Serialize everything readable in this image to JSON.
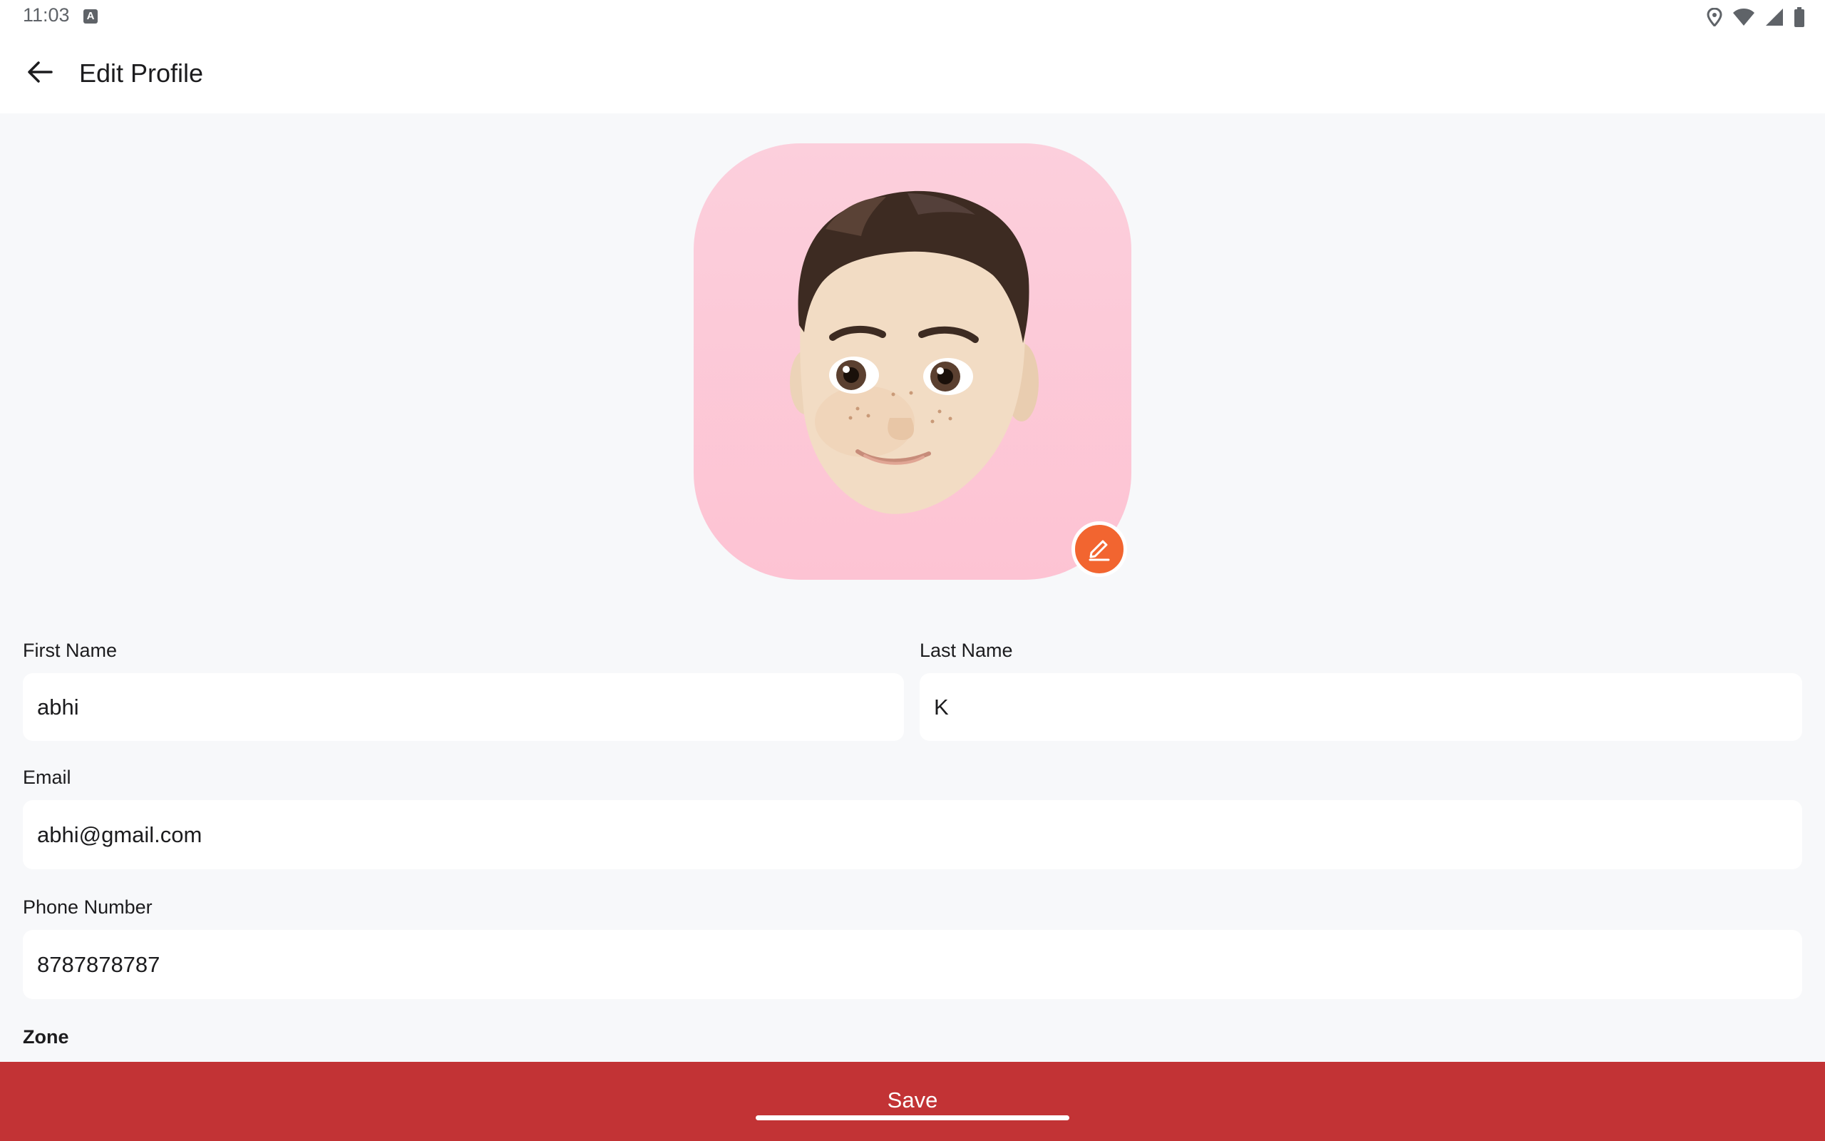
{
  "status_bar": {
    "time": "11:03",
    "notification_icon": "a-letter-icon",
    "right_icons": [
      "location-icon",
      "wifi-icon",
      "signal-icon",
      "battery-icon"
    ]
  },
  "app_bar": {
    "back_icon": "arrow-back-icon",
    "title": "Edit Profile"
  },
  "avatar": {
    "background_color": "#fcc8d6",
    "edit_icon": "pencil-icon",
    "edit_button_color": "#f26530"
  },
  "form": {
    "first_name": {
      "label": "First Name",
      "value": "abhi"
    },
    "last_name": {
      "label": "Last Name",
      "value": "K"
    },
    "email": {
      "label": "Email",
      "value": "abhi@gmail.com"
    },
    "phone": {
      "label": "Phone Number",
      "value": "8787878787"
    },
    "zone": {
      "label": "Zone"
    }
  },
  "save_button": {
    "label": "Save",
    "color": "#c23335"
  }
}
